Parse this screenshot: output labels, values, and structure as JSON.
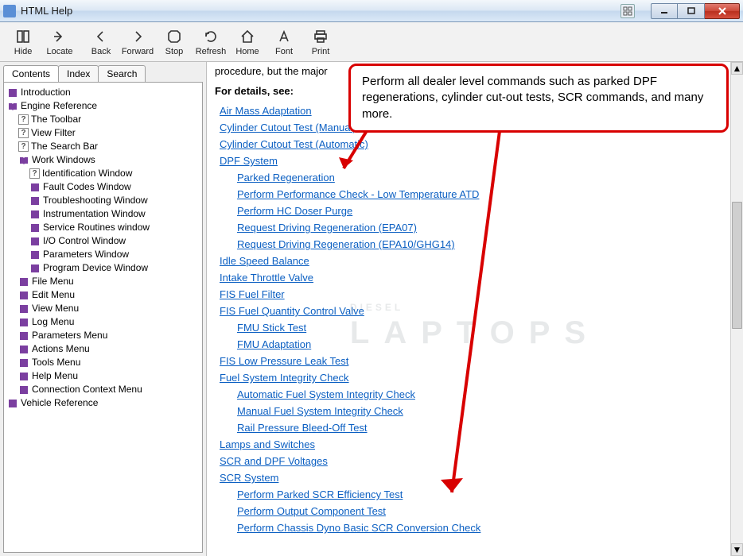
{
  "window": {
    "title": "HTML Help"
  },
  "toolbar": {
    "buttons": [
      "Hide",
      "Locate",
      "Back",
      "Forward",
      "Stop",
      "Refresh",
      "Home",
      "Font",
      "Print"
    ]
  },
  "tabs": {
    "items": [
      "Contents",
      "Index",
      "Search"
    ],
    "active": 0
  },
  "tree": {
    "introduction": "Introduction",
    "engine_reference": "Engine Reference",
    "toolbar": "The Toolbar",
    "view_filter": "View Filter",
    "search_bar": "The Search Bar",
    "work_windows": "Work Windows",
    "identification": "Identification Window",
    "fault_codes": "Fault Codes Window",
    "troubleshooting": "Troubleshooting Window",
    "instrumentation": "Instrumentation Window",
    "service_routines": "Service Routines window",
    "io_control": "I/O Control Window",
    "parameters_win": "Parameters Window",
    "program_device": "Program Device Window",
    "file_menu": "File Menu",
    "edit_menu": "Edit Menu",
    "view_menu": "View Menu",
    "log_menu": "Log Menu",
    "parameters_menu": "Parameters Menu",
    "actions_menu": "Actions Menu",
    "tools_menu": "Tools Menu",
    "help_menu": "Help Menu",
    "connection_context": "Connection Context Menu",
    "vehicle_reference": "Vehicle Reference"
  },
  "content": {
    "intro_fragment": "procedure, but the major",
    "details_header": "For details, see:",
    "links": {
      "air_mass": "Air Mass Adaptation",
      "cyl_manual": "Cylinder Cutout Test (Manual)",
      "cyl_auto": "Cylinder Cutout Test (Automatic)",
      "dpf_system": "DPF System",
      "parked_regen": "Parked Regeneration",
      "perf_check": "Perform Performance Check - Low Temperature ATD",
      "hc_doser": "Perform HC Doser Purge",
      "req_driving_07": "Request Driving Regeneration (EPA07)",
      "req_driving_10": "Request Driving Regeneration (EPA10/GHG14)",
      "idle_speed": "Idle Speed Balance",
      "intake_throttle": "Intake Throttle Valve",
      "fis_filter": "FIS Fuel Filter",
      "fis_qty": "FIS Fuel Quantity Control Valve",
      "fmu_stick": "FMU Stick Test",
      "fmu_adapt": "FMU Adaptation",
      "fis_leak": "FIS Low Pressure Leak Test",
      "fuel_integrity": "Fuel System Integrity Check",
      "auto_fuel": "Automatic Fuel System Integrity Check",
      "manual_fuel": "Manual Fuel System Integrity Check",
      "rail_pressure": "Rail Pressure Bleed-Off Test",
      "lamps": "Lamps and Switches",
      "scr_dpf_volt": "SCR and DPF Voltages",
      "scr_system": "SCR System",
      "scr_eff": "Perform Parked SCR Efficiency Test",
      "scr_output": "Perform Output Component Test",
      "scr_chassis": "Perform Chassis Dyno Basic SCR Conversion Check"
    }
  },
  "callout": {
    "text": "Perform all dealer level commands such as parked DPF regenerations, cylinder cut-out tests, SCR commands, and many more."
  },
  "watermark": {
    "line1": "DIESEL",
    "line2": "LAPTOPS"
  }
}
